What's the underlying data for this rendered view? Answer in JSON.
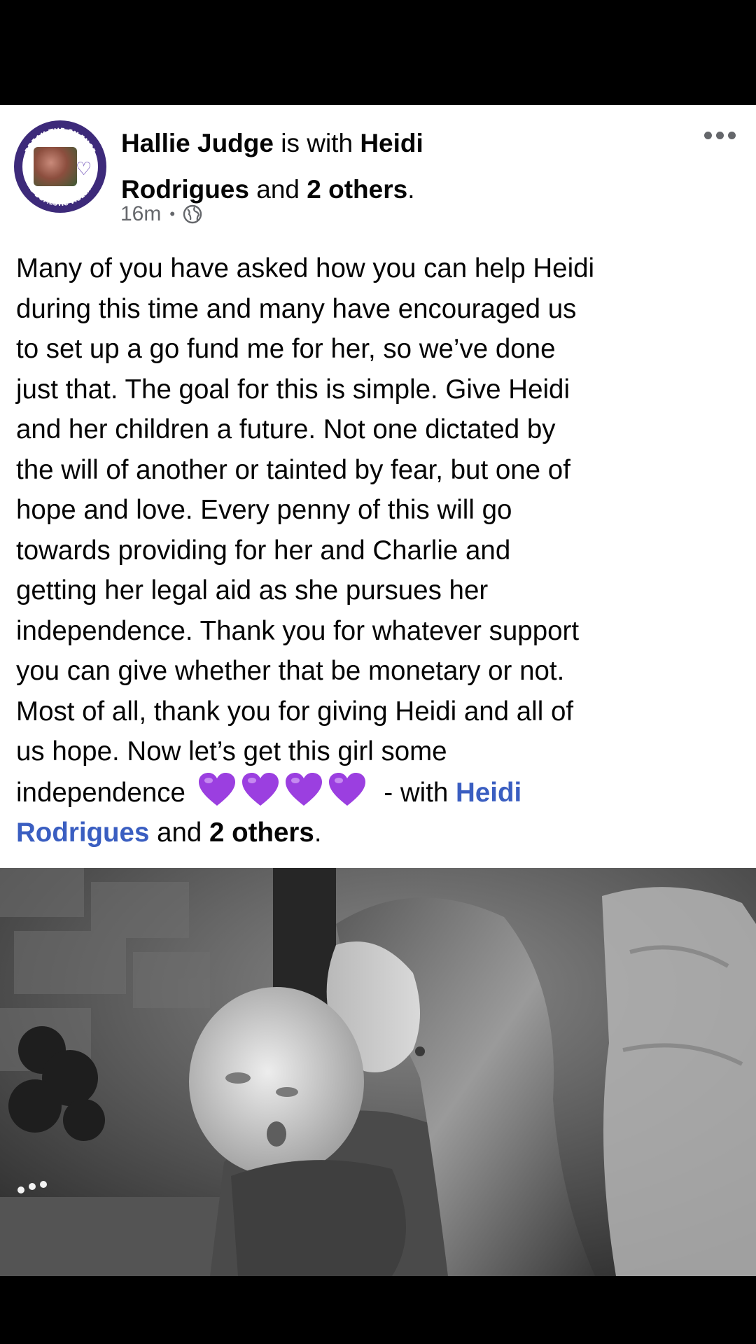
{
  "post": {
    "author": "Hallie Judge",
    "with_word": "is with",
    "tagged_name_line1": "Heidi",
    "tagged_name_line2": "Rodrigues",
    "and_word": "and",
    "others": "2 others",
    "period": ".",
    "time": "16m",
    "meta_separator": "•",
    "privacy_icon": "globe-icon",
    "more_icon": "more-options-icon",
    "body_lines": [
      "Many of you have asked how you can help Heidi",
      "during this time and many have encouraged us",
      "to set up a go fund me for her, so we’ve done",
      "just that. The goal for this is simple. Give Heidi",
      "and her children a future. Not one dictated by",
      "the will of another or tainted by fear, but one of",
      "hope and love. Every penny of this will go",
      "towards providing for her and Charlie and",
      "getting her legal aid as she pursues her",
      "independence. Thank you for whatever support",
      "you can give whether that be monetary or not.",
      "Most of all, thank you for giving Heidi and all of",
      "us hope. Now let’s get this girl some"
    ],
    "last_line_start": "independence",
    "heart_emoji_count": 4,
    "with_suffix": "- with",
    "suffix_tag_line1": "Heidi",
    "suffix_tag_line2": "Rodrigues",
    "suffix_and": "and",
    "suffix_others": "2 others",
    "suffix_period": ".",
    "avatar_ring_text_top": "BREAK THE SILENCE",
    "avatar_ring_text_bottom": "END DOMESTIC VIOLENCE"
  },
  "colors": {
    "link_blue": "#3a5ec1",
    "meta_gray": "#65676b",
    "heart_purple": "#9b3fe0",
    "avatar_ring": "#3d2a7a"
  }
}
